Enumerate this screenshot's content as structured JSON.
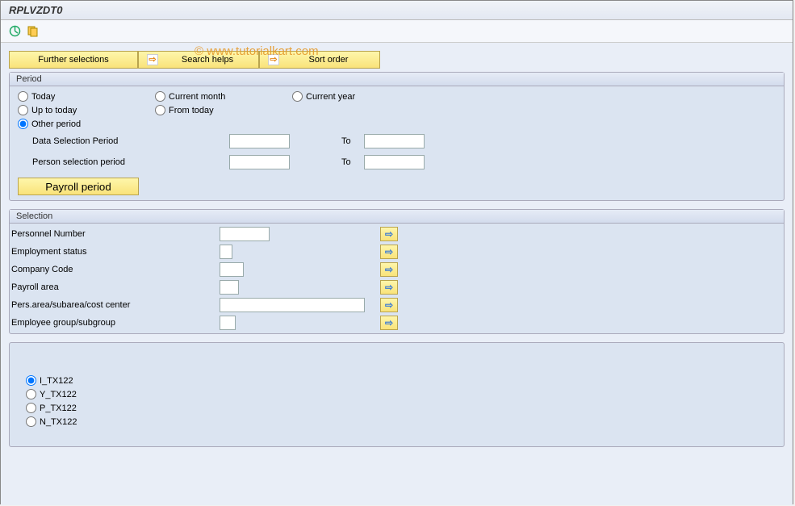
{
  "title": "RPLVZDT0",
  "watermark": "© www.tutorialkart.com",
  "action_buttons": {
    "further_selections": "Further selections",
    "search_helps": "Search helps",
    "sort_order": "Sort order"
  },
  "period": {
    "header": "Period",
    "today": "Today",
    "current_month": "Current month",
    "current_year": "Current year",
    "up_to_today": "Up to today",
    "from_today": "From today",
    "other_period": "Other period",
    "data_selection_period": "Data Selection Period",
    "person_selection_period": "Person selection period",
    "to": "To",
    "payroll_period": "Payroll period"
  },
  "selection": {
    "header": "Selection",
    "personnel_number": "Personnel Number",
    "employment_status": "Employment status",
    "company_code": "Company Code",
    "payroll_area": "Payroll area",
    "pers_area": "Pers.area/subarea/cost center",
    "employee_group": "Employee group/subgroup"
  },
  "tx": {
    "i": "I_TX122",
    "y": "Y_TX122",
    "p": "P_TX122",
    "n": "N_TX122"
  }
}
